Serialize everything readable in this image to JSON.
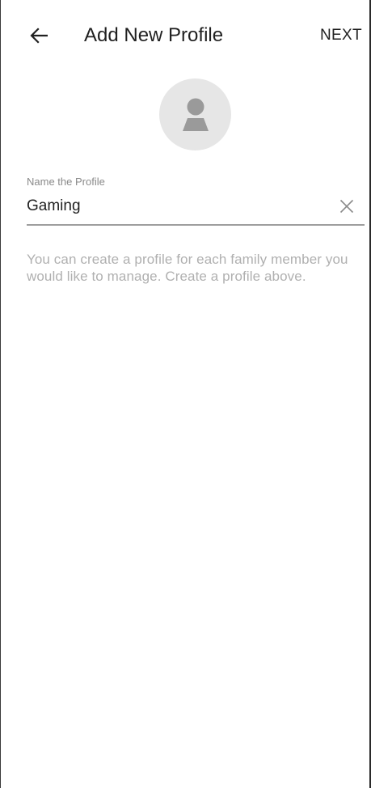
{
  "header": {
    "title": "Add New Profile",
    "next_label": "NEXT",
    "back_icon": "arrow-left-icon"
  },
  "avatar": {
    "icon": "person-icon"
  },
  "form": {
    "label": "Name the Profile",
    "value": "Gaming",
    "clear_icon": "close-icon"
  },
  "helper": {
    "text": "You can create a profile for each family member you would like to manage. Create a profile above."
  },
  "colors": {
    "text_primary": "#212121",
    "text_secondary": "#8a8a8a",
    "helper_text": "#b0b0b0",
    "avatar_bg": "#e6e6e6",
    "avatar_icon": "#9a9a9a",
    "underline": "#9e9e9e"
  }
}
